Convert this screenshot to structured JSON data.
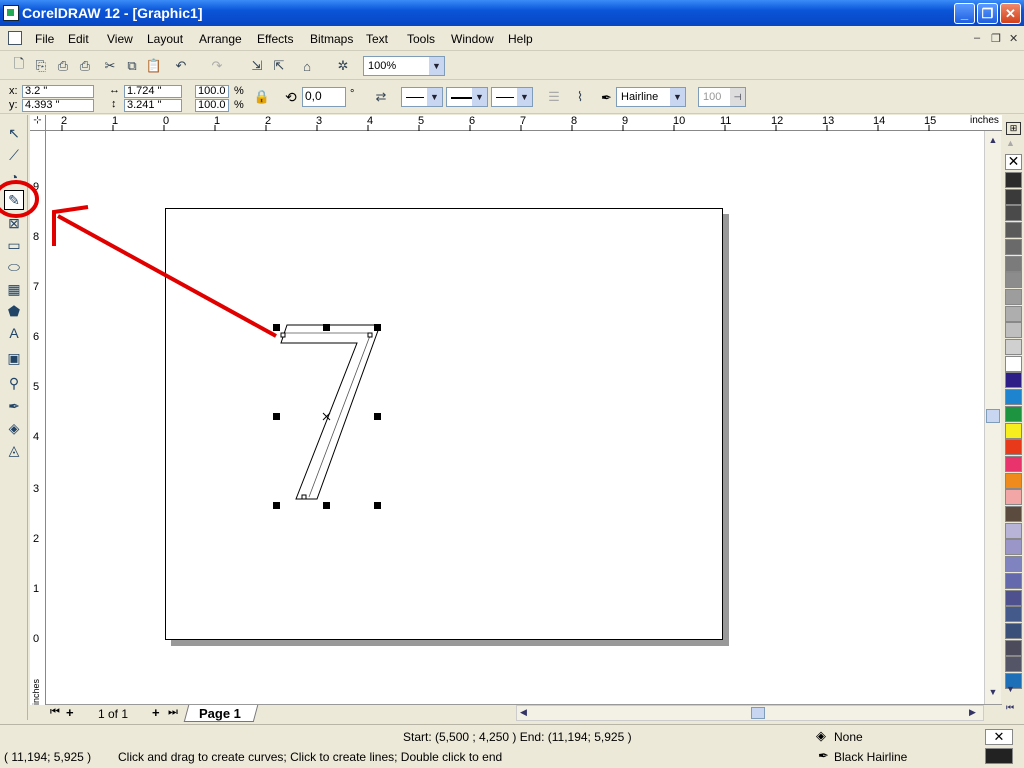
{
  "window": {
    "title": "CorelDRAW 12 - [Graphic1]"
  },
  "menu": [
    "File",
    "Edit",
    "View",
    "Layout",
    "Arrange",
    "Effects",
    "Bitmaps",
    "Text",
    "Tools",
    "Window",
    "Help"
  ],
  "toolbar": {
    "zoom": "100%"
  },
  "property_bar": {
    "x_label": "x:",
    "x": "3.2 \"",
    "y_label": "y:",
    "y": "4.393 \"",
    "width": "1.724 \"",
    "height": "3.241 \"",
    "scale_x": "100.0",
    "scale_y": "100.0",
    "pct1": "%",
    "pct2": "%",
    "angle": "0,0",
    "deg": "°",
    "outline_width": "Hairline",
    "smoothing": "100"
  },
  "rulers": {
    "top_ticks": [
      "2",
      "1",
      "0",
      "1",
      "2",
      "3",
      "4",
      "5",
      "6",
      "7",
      "8",
      "9",
      "10",
      "11",
      "12",
      "13",
      "14",
      "15"
    ],
    "top_unit": "inches",
    "left_ticks": [
      "9",
      "8",
      "7",
      "6",
      "5",
      "4",
      "3",
      "2",
      "1",
      "0"
    ],
    "left_unit": "inches"
  },
  "page_nav": {
    "count": "1 of 1",
    "tab": "Page 1"
  },
  "status": {
    "line_info": "Start: (5,500 ; 4,250 )  End: (11,194; 5,925 )",
    "fill": "None",
    "outline": "Black  Hairline",
    "cursor": "( 11,194; 5,925 )",
    "hint": "Click and drag to create curves; Click to create lines; Double click to end"
  },
  "palette": [
    "#2b2b2b",
    "#3a3a3a",
    "#4a4a4a",
    "#5a5a5a",
    "#6a6a6a",
    "#7b7b7b",
    "#8c8c8c",
    "#9d9d9d",
    "#aeaeae",
    "#bfbfbf",
    "#d0d0d0",
    "#ffffff",
    "#2c1e86",
    "#1f84d0",
    "#1d9440",
    "#f7ee20",
    "#e8391b",
    "#e8336c",
    "#ef8a1c",
    "#f3a6a6",
    "#5a4b3e",
    "#b7b4d8",
    "#9a97c8",
    "#7f84c0",
    "#6468ad",
    "#4f518e",
    "#445a8a",
    "#3b5078",
    "#4b4b5c",
    "#555568",
    "#1d6fb8"
  ],
  "colors": {
    "accent": "#0a55d8",
    "annotation": "#e00000"
  }
}
